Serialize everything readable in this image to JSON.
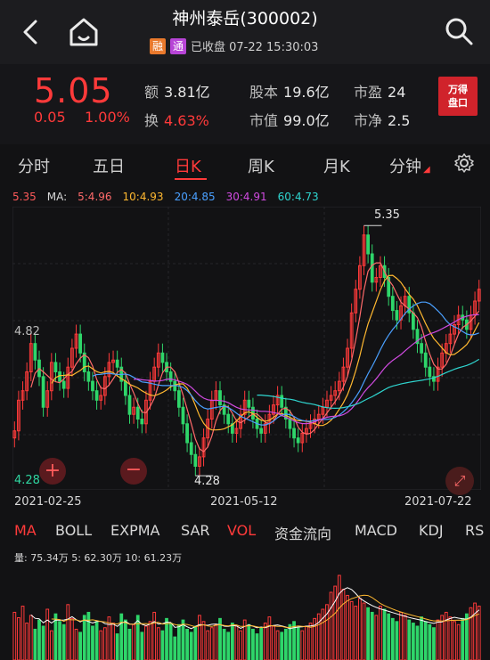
{
  "header": {
    "title": "神州泰岳(300002)",
    "tag_rong": "融",
    "tag_tong": "通",
    "status": "已收盘 07-22 15:30:03"
  },
  "quote": {
    "price": "5.05",
    "change": "0.05",
    "change_pct": "1.00%",
    "stats": [
      {
        "label": "额",
        "value": "3.81亿",
        "up": false
      },
      {
        "label": "股本",
        "value": "19.6亿",
        "up": false
      },
      {
        "label": "市盈",
        "value": "24",
        "up": false
      },
      {
        "label": "换",
        "value": "4.63%",
        "up": true
      },
      {
        "label": "市值",
        "value": "99.0亿",
        "up": false
      },
      {
        "label": "市净",
        "value": "2.5",
        "up": false
      }
    ],
    "wande_line1": "万得",
    "wande_line2": "盘口"
  },
  "tabs": [
    "分时",
    "五日",
    "日K",
    "周K",
    "月K",
    "分钟"
  ],
  "active_tab": "日K",
  "ma_legend": {
    "price": "5.35",
    "label": "MA:",
    "items": [
      {
        "text": "5:4.96",
        "color": "#ff6a6a"
      },
      {
        "text": "10:4.93",
        "color": "#ffb830"
      },
      {
        "text": "20:4.85",
        "color": "#4aa0ff"
      },
      {
        "text": "30:4.91",
        "color": "#d04ae0"
      },
      {
        "text": "60:4.73",
        "color": "#2fd6d0"
      }
    ]
  },
  "chart_data": {
    "type": "candlestick",
    "y_axis_labels": [
      "4.82",
      "4.28"
    ],
    "high_label": "5.35",
    "low_label": "4.28",
    "x_axis_labels": [
      "2021-02-25",
      "2021-05-12",
      "2021-07-22"
    ],
    "ylim": [
      4.2,
      5.4
    ],
    "closes": [
      4.45,
      4.58,
      4.62,
      4.7,
      4.82,
      4.75,
      4.68,
      4.55,
      4.62,
      4.74,
      4.7,
      4.66,
      4.63,
      4.72,
      4.8,
      4.86,
      4.78,
      4.7,
      4.66,
      4.62,
      4.58,
      4.6,
      4.68,
      4.74,
      4.75,
      4.72,
      4.66,
      4.6,
      4.52,
      4.55,
      4.5,
      4.48,
      4.58,
      4.66,
      4.72,
      4.78,
      4.74,
      4.7,
      4.66,
      4.62,
      4.55,
      4.48,
      4.4,
      4.35,
      4.3,
      4.34,
      4.42,
      4.5,
      4.58,
      4.62,
      4.56,
      4.52,
      4.48,
      4.44,
      4.46,
      4.52,
      4.58,
      4.55,
      4.5,
      4.46,
      4.44,
      4.48,
      4.52,
      4.56,
      4.6,
      4.55,
      4.5,
      4.46,
      4.42,
      4.4,
      4.44,
      4.46,
      4.48,
      4.5,
      4.52,
      4.55,
      4.58,
      4.6,
      4.62,
      4.66,
      4.72,
      4.8,
      4.95,
      5.05,
      5.15,
      5.28,
      5.2,
      5.08,
      5.1,
      5.15,
      5.1,
      5.02,
      4.96,
      4.92,
      4.98,
      5.02,
      4.95,
      4.88,
      4.82,
      4.78,
      4.72,
      4.68,
      4.66,
      4.72,
      4.78,
      4.82,
      4.86,
      4.9,
      4.94,
      4.92,
      4.88,
      4.94,
      5.0,
      5.05
    ]
  },
  "indicators": [
    "MA",
    "BOLL",
    "EXPMA",
    "SAR",
    "VOL",
    "资金流向",
    "MACD",
    "KDJ",
    "RS"
  ],
  "indicator_active": [
    "MA",
    "VOL"
  ],
  "volume": {
    "label": "量: 75.34万  5: 62.30万  10: 61.23万",
    "values": [
      62,
      55,
      70,
      48,
      58,
      40,
      52,
      44,
      66,
      38,
      60,
      50,
      46,
      72,
      54,
      40,
      36,
      58,
      62,
      44,
      50,
      38,
      42,
      56,
      48,
      34,
      60,
      52,
      40,
      46,
      58,
      36,
      44,
      50,
      62,
      42,
      38,
      54,
      48,
      30,
      46,
      52,
      40,
      36,
      44,
      58,
      50,
      38,
      42,
      46,
      54,
      40,
      36,
      48,
      44,
      38,
      52,
      46,
      40,
      34,
      42,
      48,
      56,
      44,
      38,
      36,
      40,
      46,
      50,
      42,
      38,
      44,
      48,
      54,
      60,
      66,
      72,
      88,
      96,
      110,
      92,
      84,
      76,
      70,
      80,
      74,
      68,
      62,
      58,
      70,
      66,
      60,
      54,
      50,
      62,
      58,
      52,
      48,
      44,
      56,
      50,
      46,
      42,
      52,
      58,
      62,
      56,
      50,
      46,
      54,
      60,
      68,
      74,
      70
    ]
  }
}
